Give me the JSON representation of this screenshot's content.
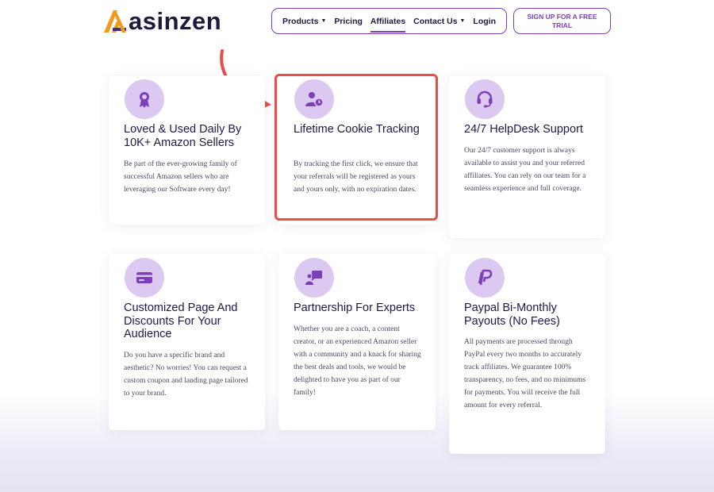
{
  "brand": {
    "name": "asinzen"
  },
  "nav": {
    "items": [
      {
        "label": "Products",
        "dropdown": true,
        "active": false
      },
      {
        "label": "Pricing",
        "dropdown": false,
        "active": false
      },
      {
        "label": "Affiliates",
        "dropdown": false,
        "active": true
      },
      {
        "label": "Contact Us",
        "dropdown": true,
        "active": false
      },
      {
        "label": "Login",
        "dropdown": false,
        "active": false
      }
    ],
    "cta_label": "SIGN UP FOR A FREE TRIAL"
  },
  "colors": {
    "accent": "#7b3fb8",
    "icon_bg": "#dcc9f2",
    "icon_fg": "#7b3fb8",
    "highlight": "#ea4c46",
    "logo_orange": "#f29a1f"
  },
  "features": [
    {
      "icon": "award-ribbon-icon",
      "title": "Loved & Used Daily By 10K+ Amazon Sellers",
      "body": "Be part of the ever-growing family of successful Amazon sellers who are leveraging our Software every day!"
    },
    {
      "icon": "user-clock-icon",
      "title": "Lifetime Cookie Tracking",
      "body": "By tracking the first click, we ensure that your referrals will be registered as yours and yours only, with no expiration dates."
    },
    {
      "icon": "headset-icon",
      "title": "24/7 HelpDesk Support",
      "body": "Our 24/7 customer support is always available to assist you and your referred affiliates. You can rely on our team for a seamless experience and full coverage."
    },
    {
      "icon": "credit-card-icon",
      "title": "Customized Page And Discounts For Your Audience",
      "body": "Do you have a specific brand and aesthetic? No worries! You can request a custom coupon and landing page tailored to your brand."
    },
    {
      "icon": "presenter-icon",
      "title": "Partnership For Experts",
      "body": "Whether you are a coach, a content creator, or an experienced Amazon seller with a community and a knack for sharing the best deals and tools, we would be delighted to have you as part of our family!"
    },
    {
      "icon": "paypal-icon",
      "title": "Paypal Bi-Monthly Payouts (No Fees)",
      "body": "All payments are processed through PayPal every two months to accurately track affiliates. We guarantee 100% transparency, no fees, and no minimums for payments. You will receive the full amount for every referral."
    }
  ]
}
